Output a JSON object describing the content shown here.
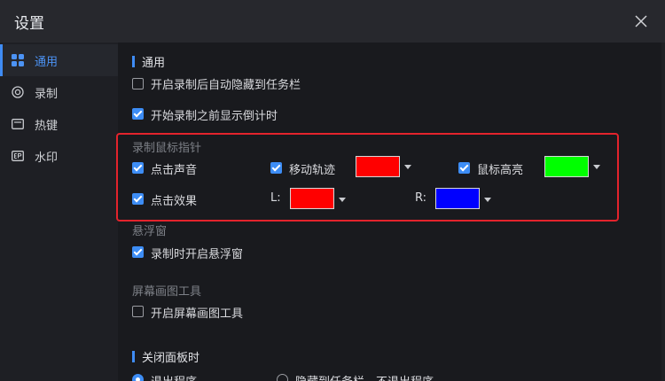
{
  "window": {
    "title": "设置"
  },
  "sidebar": {
    "items": [
      {
        "label": "通用",
        "icon": "grid-icon",
        "active": true
      },
      {
        "label": "录制",
        "icon": "record-icon",
        "active": false
      },
      {
        "label": "热键",
        "icon": "keyboard-icon",
        "active": false
      },
      {
        "label": "水印",
        "icon": "watermark-icon",
        "active": false
      }
    ]
  },
  "general": {
    "section_title": "通用",
    "auto_hide": {
      "label": "开启录制后自动隐藏到任务栏",
      "checked": false
    },
    "countdown": {
      "label": "开始录制之前显示倒计时",
      "checked": true
    }
  },
  "cursor": {
    "group_title": "录制鼠标指针",
    "click_sound": {
      "label": "点击声音",
      "checked": true
    },
    "move_track": {
      "label": "移动轨迹",
      "checked": true,
      "color": "#ff0000"
    },
    "cursor_highlight": {
      "label": "鼠标高亮",
      "checked": true,
      "color": "#00ff00"
    },
    "click_effect": {
      "label": "点击效果",
      "checked": true
    },
    "left_label": "L:",
    "left_color": "#ff0000",
    "right_label": "R:",
    "right_color": "#0000ff"
  },
  "floating": {
    "group_title": "悬浮窗",
    "open_on_record": {
      "label": "录制时开启悬浮窗",
      "checked": true
    }
  },
  "drawing": {
    "group_title": "屏幕画图工具",
    "enable": {
      "label": "开启屏幕画图工具",
      "checked": false
    }
  },
  "close_panel": {
    "section_title": "关闭面板时",
    "options": [
      {
        "label": "退出程序",
        "selected": true
      },
      {
        "label": "隐藏到任务栏，不退出程序",
        "selected": false
      }
    ]
  },
  "colors": {
    "accent": "#3d8df5",
    "highlight_border": "#e3232c"
  }
}
